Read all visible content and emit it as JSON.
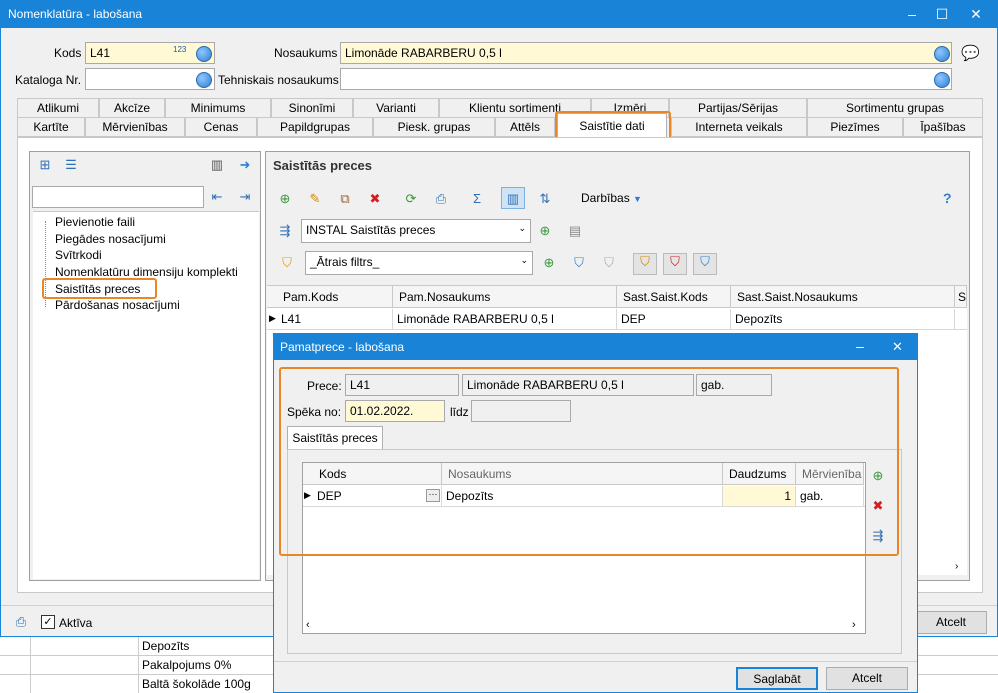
{
  "window": {
    "title": "Nomenklatūra - labošana",
    "minimize": "–",
    "maximize": "☐",
    "close": "✕"
  },
  "form": {
    "kods_label": "Kods",
    "kods_value": "L41",
    "nosaukums_label": "Nosaukums",
    "nosaukums_value": "Limonāde RABARBERU 0,5 l",
    "kataloga_label": "Kataloga Nr.",
    "kataloga_value": "",
    "tehn_label": "Tehniskais nosaukums",
    "tehn_value": "",
    "num_icon_text": "123"
  },
  "tabs_top": [
    "Atlikumi",
    "Akcīze",
    "Minimums",
    "Sinonīmi",
    "Varianti",
    "Klientu sortimenti",
    "Izmēri",
    "Partijas/Sērijas",
    "Sortimentu grupas"
  ],
  "tabs_bottom": [
    "Kartīte",
    "Mērvienības",
    "Cenas",
    "Papildgrupas",
    "Piesk. grupas",
    "Attēls",
    "Saistītie dati",
    "Interneta veikals",
    "Piezīmes",
    "Īpašības"
  ],
  "tree": {
    "items": [
      "Pievienotie faili",
      "Piegādes nosacījumi",
      "Svītrkodi",
      "Nomenklatūru dimensiju komplekti",
      "Saistītās preces",
      "Pārdošanas nosacījumi"
    ]
  },
  "right_panel": {
    "title": "Saistītās preces",
    "actions_label": "Darbības",
    "help": "?",
    "view_select": "INSTAL Saistītās preces",
    "filter_select": "_Ātrais filtrs_",
    "columns": [
      "Pam.Kods",
      "Pam.Nosaukums",
      "Sast.Saist.Kods",
      "Sast.Saist.Nosaukums",
      "S"
    ],
    "row": [
      "L41",
      "Limonāde RABARBERU 0,5 l",
      "DEP",
      "Depozīts"
    ]
  },
  "bottom_bar": {
    "active_label": "Aktīva",
    "cancel": "Atcelt"
  },
  "bg_list": [
    "Depozīts",
    "Pakalpojums 0%",
    "Baltā šokolāde 100g"
  ],
  "dialog": {
    "title": "Pamatprece - labošana",
    "prece_label": "Prece:",
    "prece_code": "L41",
    "prece_name": "Limonāde RABARBERU 0,5 l",
    "prece_unit": "gab.",
    "speka_label": "Spēka no:",
    "speka_value": "01.02.2022.",
    "lidz_label": "līdz",
    "lidz_value": "",
    "tab": "Saistītās preces",
    "columns": [
      "Kods",
      "Nosaukums",
      "Daudzums",
      "Mērvienība"
    ],
    "row": {
      "kods": "DEP",
      "nosaukums": "Depozīts",
      "daudzums": "1",
      "mervieniba": "gab."
    },
    "save": "Saglabāt",
    "cancel": "Atcelt"
  }
}
